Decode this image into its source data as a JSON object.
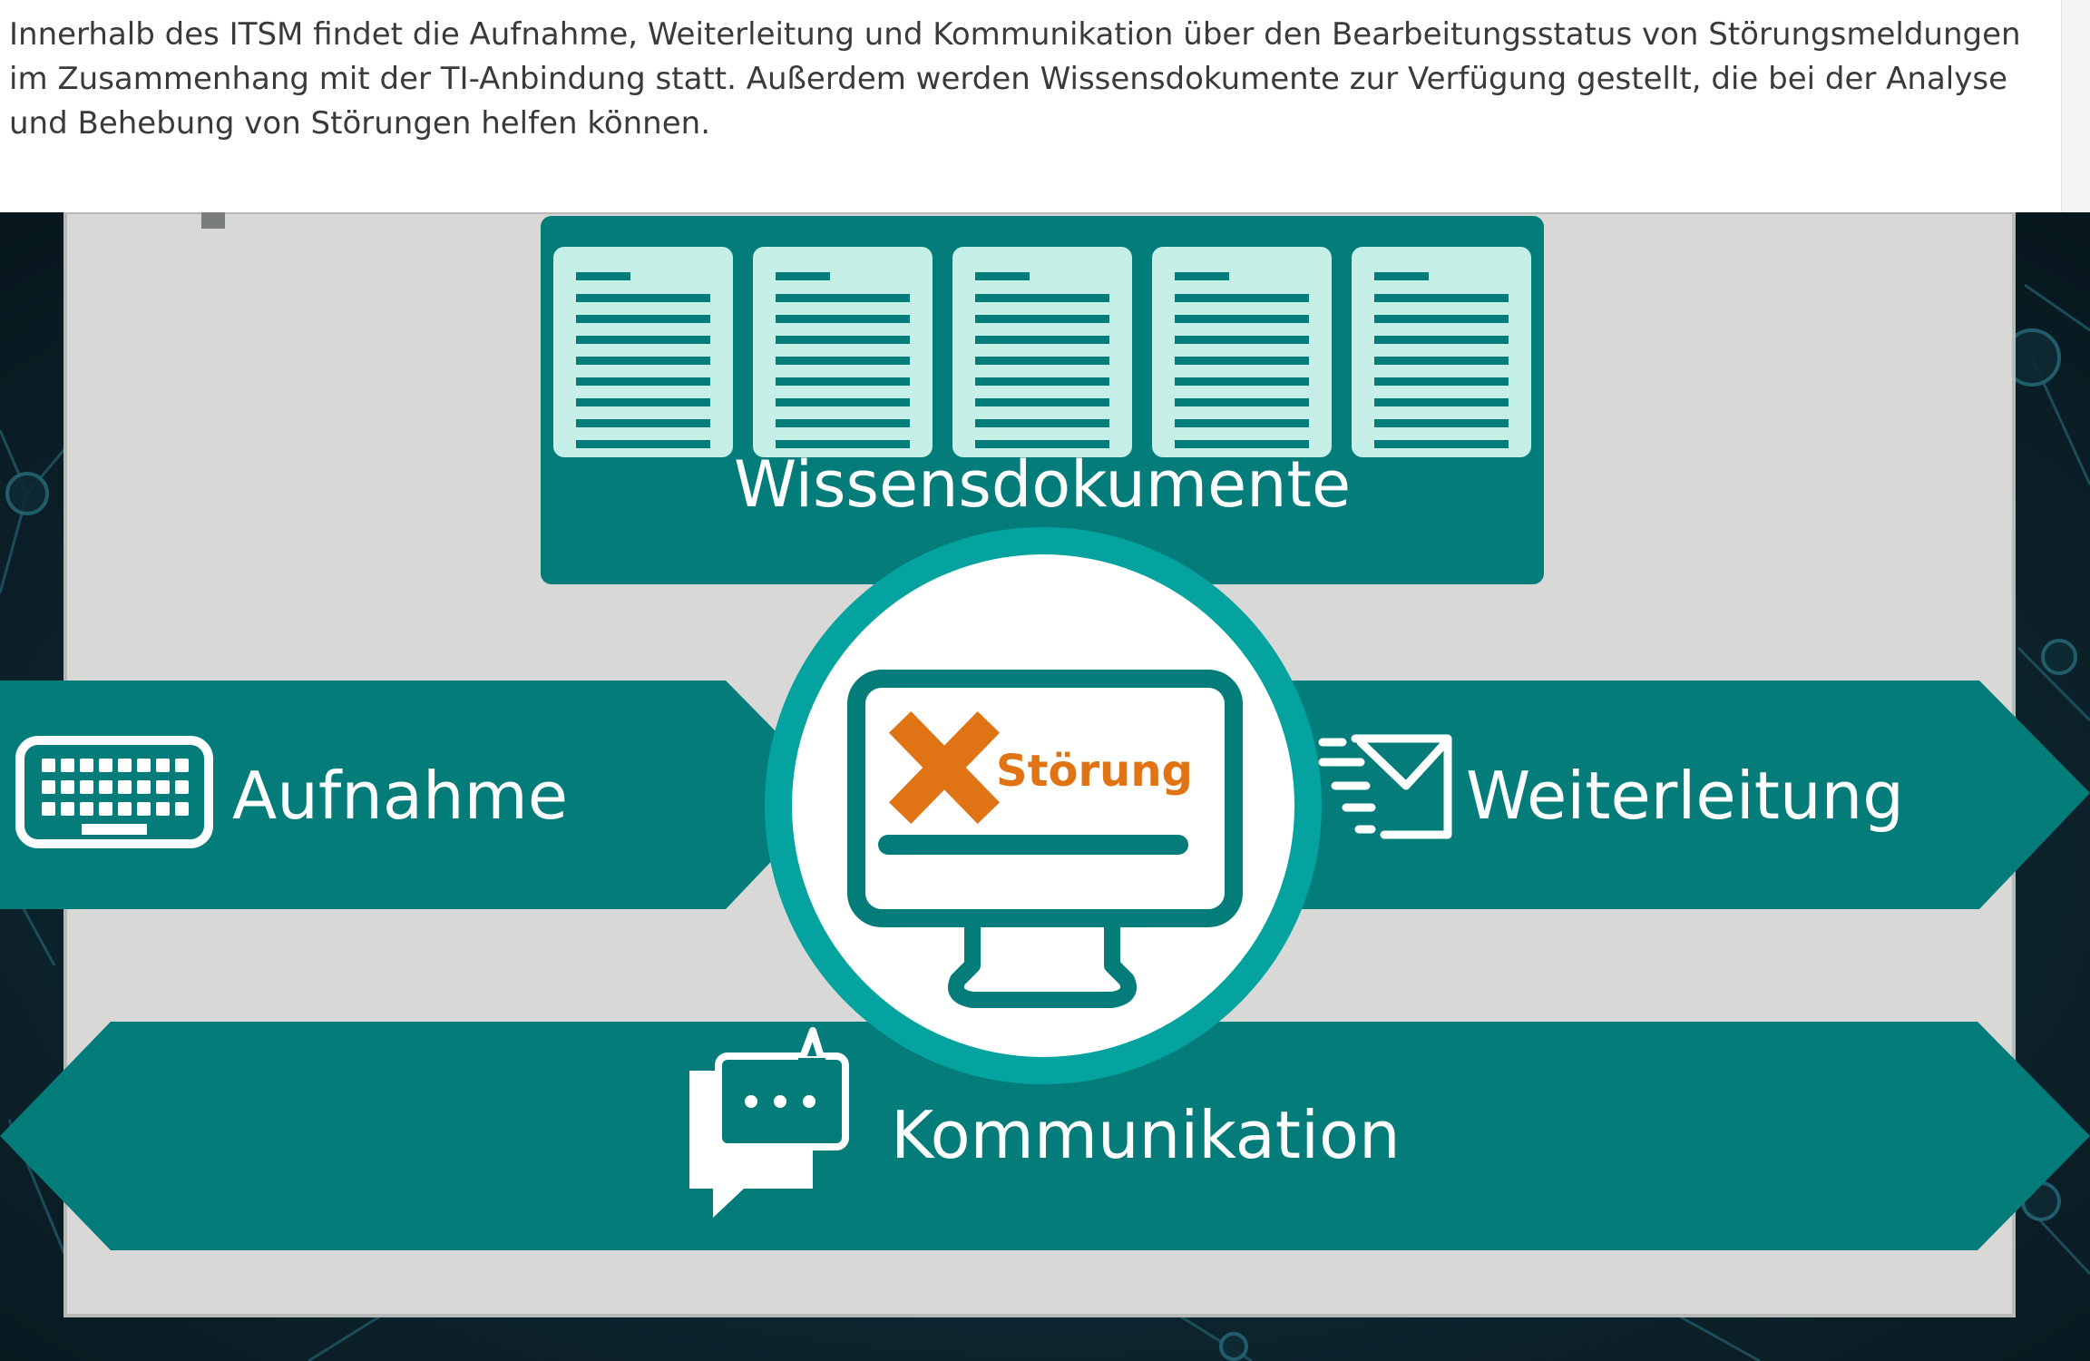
{
  "intro": {
    "paragraph": "Innerhalb des ITSM findet die Aufnahme, Weiterleitung und Kommunikation über den Bearbeitungsstatus von Störungsmeldungen im Zusammenhang mit der TI-Anbindung statt. Außerdem werden Wissensdokumente zur Verfügung gestellt, die bei der Analyse und Behebung von Störungen helfen können."
  },
  "diagram": {
    "knowledge_docs": {
      "label": "Wissensdokumente",
      "count": 5,
      "icon": "document-icon"
    },
    "center": {
      "status_text": "Störung",
      "icon": "monitor-icon",
      "status_icon": "error-x-icon"
    },
    "left_arrow": {
      "label": "Aufnahme",
      "icon": "keyboard-icon"
    },
    "right_arrow": {
      "label": "Weiterleitung",
      "icon": "fast-mail-icon"
    },
    "bottom_arrow": {
      "label": "Kommunikation",
      "icon": "chat-bubbles-icon"
    }
  },
  "colors": {
    "teal": "#037c7a",
    "teal_ring": "#04a3a0",
    "doc_fill": "#c6efe8",
    "orange": "#e07414",
    "panel": "#d8d9d6",
    "background": "#0e1f28"
  }
}
